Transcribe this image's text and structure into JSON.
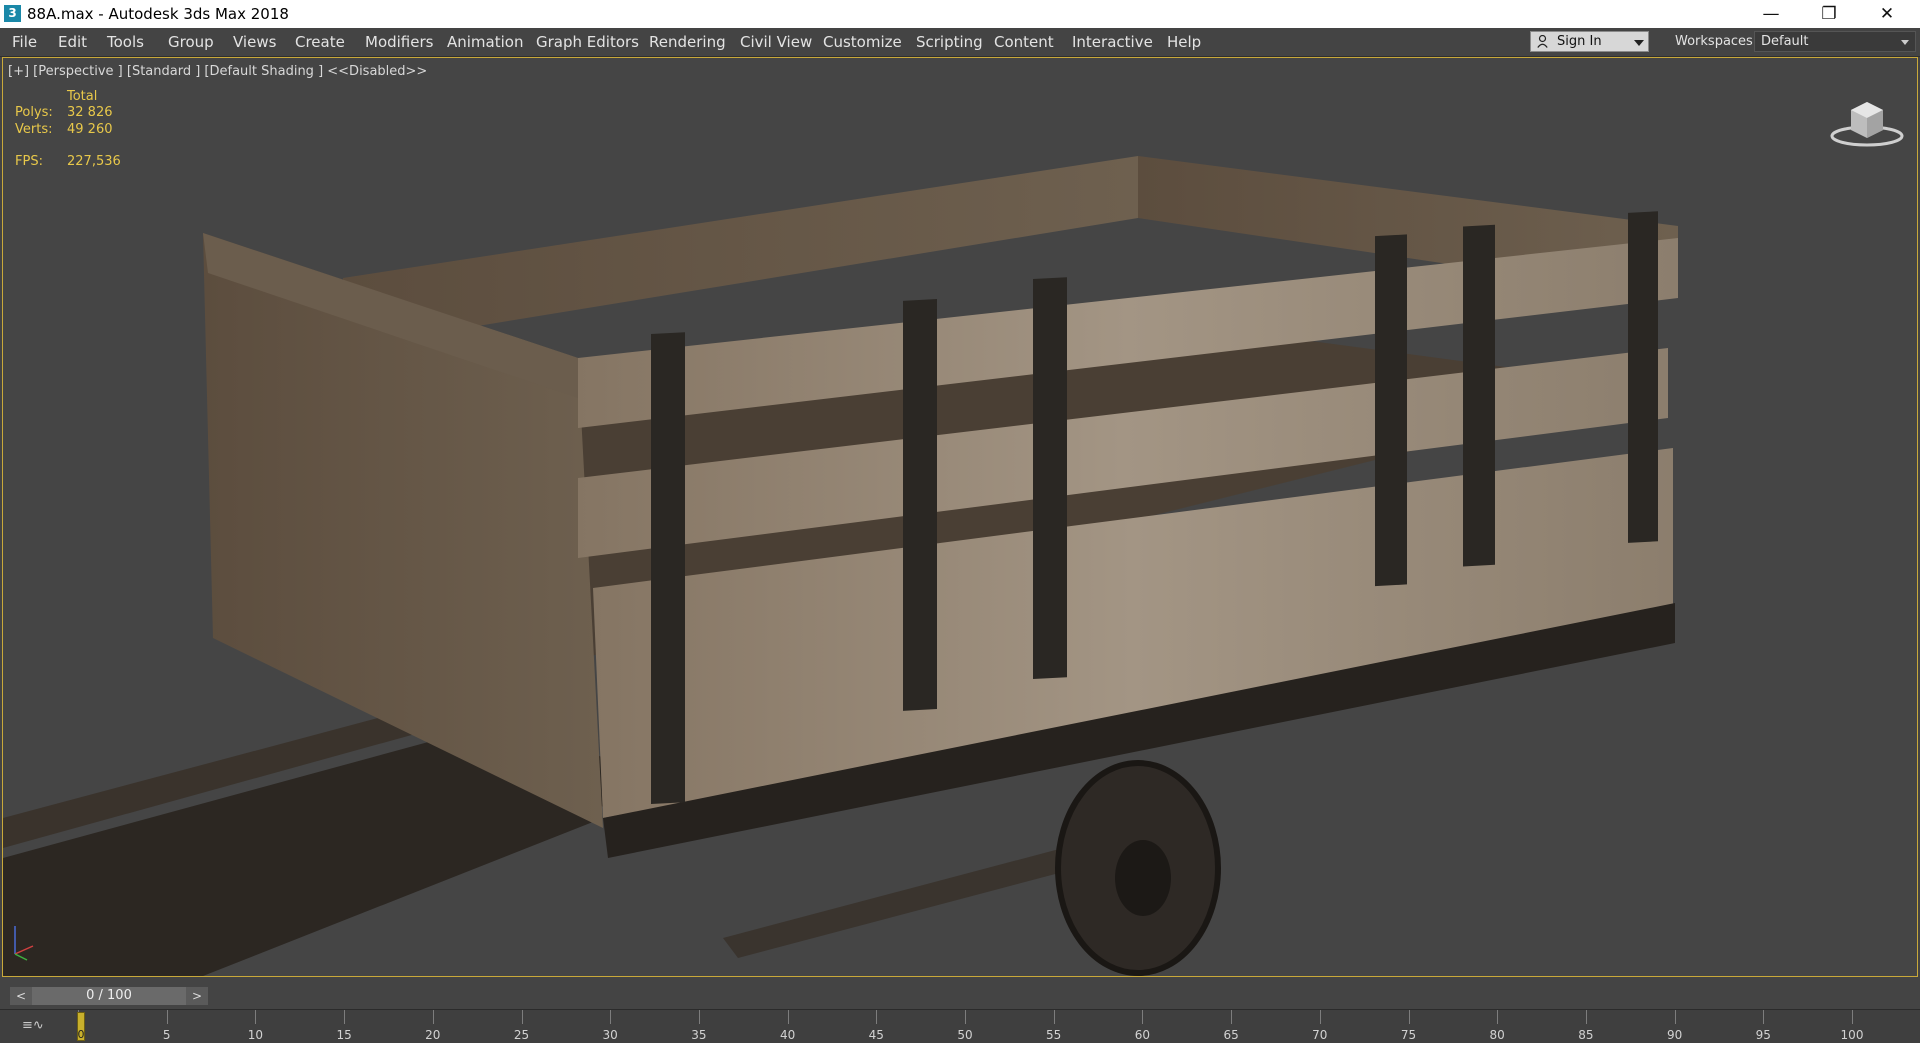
{
  "window": {
    "app_icon_glyph": "3",
    "title": "88A.max - Autodesk 3ds Max 2018",
    "controls": {
      "minimize": "—",
      "restore": "❐",
      "close": "✕"
    }
  },
  "menu": {
    "items": [
      "File",
      "Edit",
      "Tools",
      "Group",
      "Views",
      "Create",
      "Modifiers",
      "Animation",
      "Graph Editors",
      "Rendering",
      "Civil View",
      "Customize",
      "Scripting",
      "Content",
      "Interactive",
      "Help"
    ],
    "sign_in": "Sign In",
    "workspaces_label": "Workspaces:",
    "workspaces_value": "Default"
  },
  "viewport": {
    "label": "[+] [Perspective ] [Standard ] [Default Shading ]  <<Disabled>>",
    "stats": {
      "total_header": "Total",
      "polys_label": "Polys:",
      "polys_value": "32 826",
      "verts_label": "Verts:",
      "verts_value": "49 260",
      "fps_label": "FPS:",
      "fps_value": "227,536"
    },
    "border_color": "#c9a93a",
    "stat_color": "#e8c84a"
  },
  "timeline": {
    "prev": "<",
    "frame_display": "0 / 100",
    "next": ">",
    "curve_icon": "≡∿",
    "current_frame": "0",
    "ticks": [
      0,
      5,
      10,
      15,
      20,
      25,
      30,
      35,
      40,
      45,
      50,
      55,
      60,
      65,
      70,
      75,
      80,
      85,
      90,
      95,
      100
    ],
    "tick_labels": [
      "5",
      "10",
      "15",
      "20",
      "25",
      "30",
      "35",
      "40",
      "45",
      "50",
      "55",
      "60",
      "65",
      "70",
      "75",
      "80",
      "85",
      "90",
      "95",
      "100"
    ]
  }
}
